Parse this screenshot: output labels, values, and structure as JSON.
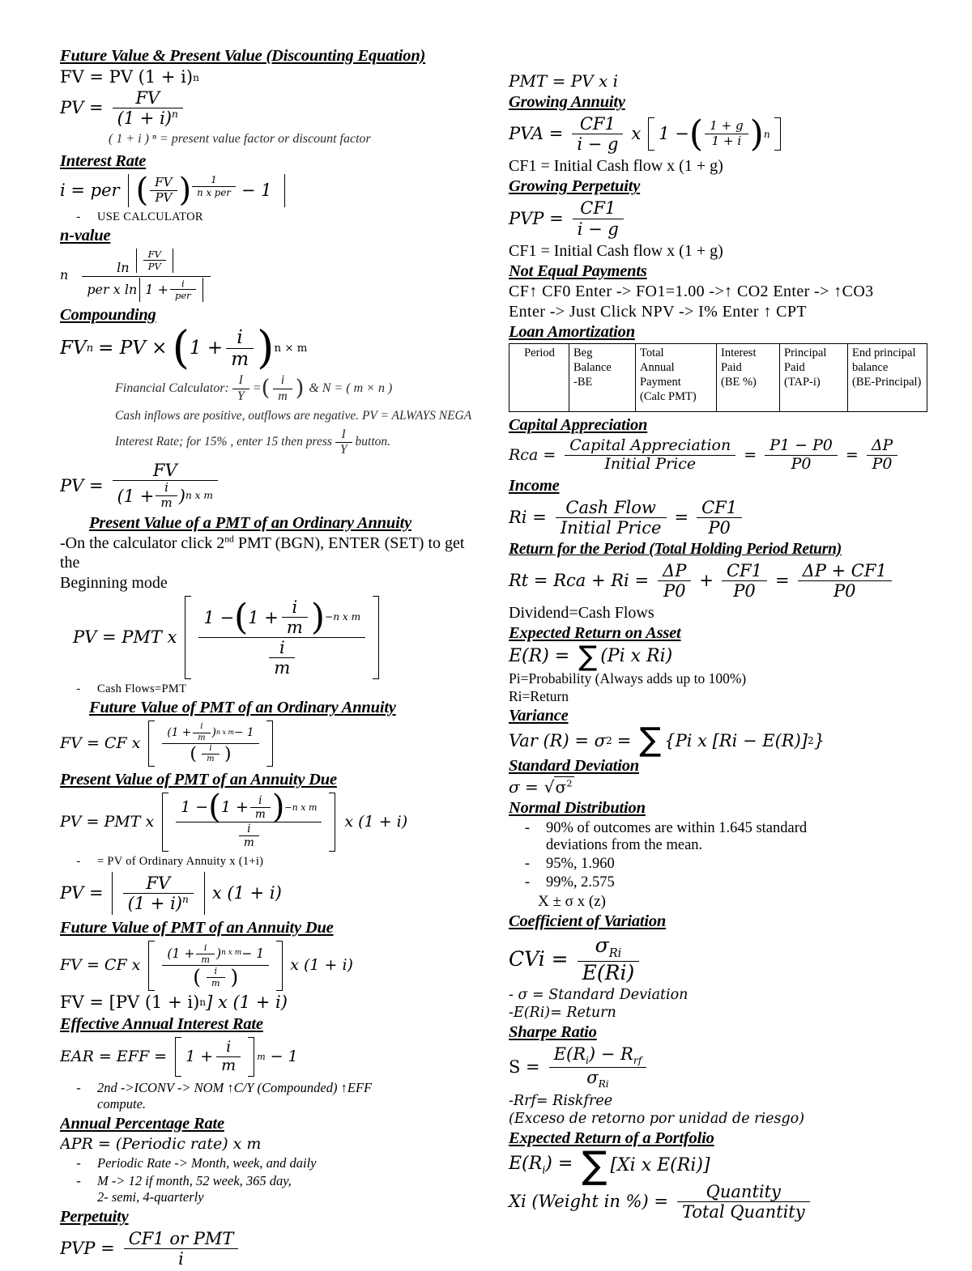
{
  "document": {
    "type": "finance-formula-cheat-sheet",
    "title": "Finance Formula Sheet"
  },
  "left_column": {
    "s1": {
      "heading": "Future Value & Present Value (Discounting Equation)",
      "fv_line": "FV = PV (1 + i)",
      "fv_exp": "n",
      "pv_lhs": "PV =",
      "pv_num": "FV",
      "pv_den_base": "(1 + i)",
      "pv_den_exp": "n",
      "factor_note": "( 1 + i ) ⁿ = present value factor or discount factor"
    },
    "s2": {
      "heading": "Interest Rate",
      "lhs": "i  =  per",
      "frac_num": "FV",
      "frac_den": "PV",
      "exp_num": "1",
      "exp_den": "n x per",
      "minus_one": "− 1",
      "bullet": "USE CALCULATOR"
    },
    "s3": {
      "heading": "n-value",
      "lhs": "n",
      "num_ln": "ln",
      "num_frac_num": "FV",
      "num_frac_den": "PV",
      "den_pre": "per x ln",
      "den_one": "1 +",
      "den_frac_num": "i",
      "den_frac_den": "per"
    },
    "s4": {
      "heading": "Compounding",
      "lhs": "FV",
      "lhs_sub": "n",
      "eq_mid": "= PV ×",
      "one_plus": "1 +",
      "frac_num": "i",
      "frac_den": "m",
      "exp": "n × m",
      "calc_note_pre": "Financial Calculator:",
      "calc_i": "I",
      "calc_y": "Y",
      "calc_eq": "=",
      "calc_fi": "i",
      "calc_fm": "m",
      "calc_tail": "&  N = ( m × n )",
      "note_cash": "Cash inflows are positive, outflows are negative. PV = ALWAYS NEGA",
      "note_rate_pre": "Interest Rate; for 15% , enter 15 then press",
      "note_rate_i": "I",
      "note_rate_y": "Y",
      "note_rate_post": "button."
    },
    "s5": {
      "lhs": "PV =",
      "num": "FV",
      "den_open": "(1 +",
      "den_fi": "i",
      "den_fm": "m",
      "den_close": ")",
      "den_exp": "n x m"
    },
    "s6": {
      "heading": "Present Value of a PMT of an Ordinary Annuity",
      "line1": "-On the calculator click 2",
      "line1_sup": "nd",
      "line1_rest": " PMT (BGN), ENTER (SET) to get the",
      "line2": "Beginning mode",
      "lhs": "PV = PMT x",
      "num_one_minus": "1 −",
      "num_one_plus": "1 +",
      "num_fi": "i",
      "num_fm": "m",
      "num_exp": "−n x m",
      "den_fi": "i",
      "den_fm": "m",
      "bullet": "Cash Flows=PMT"
    },
    "s7": {
      "heading": "Future Value of PMT of an Ordinary Annuity",
      "lhs": "FV = CF x",
      "num_open": "(1 +",
      "num_fi": "i",
      "num_fm": "m",
      "num_close": ")",
      "num_exp": "n x m",
      "num_minus": "− 1",
      "den_fi": "i",
      "den_fm": "m"
    },
    "s8": {
      "heading": "Present Value of PMT of an Annuity Due",
      "lhs": "PV = PMT x",
      "num_one_minus": "1 −",
      "num_one_plus": "1 +",
      "num_fi": "i",
      "num_fm": "m",
      "num_exp": "−n x m",
      "den_fi": "i",
      "den_fm": "m",
      "tail": "x (1 + i)",
      "bullet": "= PV of Ordinary Annuity x (1+i)",
      "pv2_lhs": "PV =",
      "pv2_num": "FV",
      "pv2_den": "(1 + i)",
      "pv2_den_exp": "n",
      "pv2_tail": "x (1 + i)"
    },
    "s9": {
      "heading": "Future Value of PMT of an Annuity Due",
      "lhs": "FV = CF x",
      "num_open": "(1 +",
      "num_fi": "i",
      "num_fm": "m",
      "num_close": ")",
      "num_exp": "n x m",
      "num_minus": "− 1",
      "den_fi": "i",
      "den_fm": "m",
      "tail": "x (1 + i)",
      "fv_line_pre": "FV = [PV (1 + i)",
      "fv_line_exp": "n",
      "fv_line_post": "] x (1 + i)"
    },
    "s10": {
      "heading": "Effective Annual Interest Rate",
      "lhs": "EAR = EFF =",
      "one_plus": "1 +",
      "fi": "i",
      "fm": "m",
      "exp": "m",
      "minus_one": "− 1",
      "bullet1": "2nd ->ICONV -> NOM ↑C/Y (Compounded) ↑EFF",
      "bullet1b": "compute."
    },
    "s11": {
      "heading": "Annual Percentage Rate",
      "formula": "APR = (Periodic rate) x m",
      "bullet1": "Periodic Rate -> Month, week, and daily",
      "bullet2": "M -> 12 if month, 52 week, 365 day,",
      "bullet2b": "2- semi, 4-quarterly"
    },
    "s12": {
      "heading": "Perpetuity",
      "lhs": "PVP =",
      "num": "CF1 or PMT",
      "den": "i"
    }
  },
  "right_column": {
    "r1": {
      "pmt_line": "PMT = PV x i"
    },
    "r2": {
      "heading": "Growing Annuity",
      "lhs": "PVA =",
      "f1_num": "CF1",
      "f1_den": "i − g",
      "x": "x",
      "one_minus": "1 −",
      "f2_num": "1 + g",
      "f2_den": "1 + i",
      "exp": "n",
      "cf_note": "CF1 = Initial Cash flow x (1 + g)"
    },
    "r3": {
      "heading": "Growing Perpetuity",
      "lhs": "PVP =",
      "num": "CF1",
      "den": "i − g",
      "cf_note": "CF1 = Initial Cash flow x (1 + g)"
    },
    "r4": {
      "heading": "Not Equal Payments",
      "line1": "CF↑ CF0 Enter -> FO1=1.00 ->↑ CO2 Enter -> ↑CO3",
      "line2": "Enter -> Just Click NPV -> I% Enter ↑ CPT"
    },
    "r5": {
      "heading": "Loan Amortization",
      "table": {
        "columns": [
          "Period",
          "Beg\nBalance\n-BE",
          "Total\nAnnual\nPayment\n(Calc PMT)",
          "Interest\nPaid\n(BE %)",
          "Principal\nPaid\n(TAP-i)",
          "End principal\nbalance\n(BE-Principal)"
        ],
        "rows": []
      }
    },
    "r6": {
      "heading": "Capital Appreciation",
      "lhs": "Rca =",
      "f1_num": "Capital Appreciation",
      "f1_den": "Initial Price",
      "eq1": "=",
      "f2_num": "P1 − P0",
      "f2_den": "P0",
      "eq2": "=",
      "f3_num": "ΔP",
      "f3_den": "P0"
    },
    "r7": {
      "heading": "Income",
      "lhs": "Ri =",
      "f1_num": "Cash Flow",
      "f1_den": "Initial Price",
      "eq1": "=",
      "f2_num": "CF1",
      "f2_den": "P0"
    },
    "r8": {
      "heading": "Return for the Period (Total Holding Period Return)",
      "lhs": "Rt = Rca + Ri =",
      "f1_num": "ΔP",
      "f1_den": "P0",
      "plus": "+",
      "f2_num": "CF1",
      "f2_den": "P0",
      "eq": "=",
      "f3_num": "ΔP + CF1",
      "f3_den": "P0",
      "dividend_note": "Dividend=Cash Flows"
    },
    "r9": {
      "heading": "Expected Return on Asset",
      "formula_lhs": "E(R) =",
      "formula_rhs": "(Pi x Ri)",
      "note1": "Pi=Probability (Always adds up to 100%)",
      "note2": "Ri=Return"
    },
    "r10": {
      "heading": "Variance",
      "lhs": "Var (R) =  σ",
      "lhs_exp": "2",
      "eq": "=",
      "rhs": "{Pi x [Ri − E(R)]",
      "rhs_exp": "2",
      "rhs_close": "}"
    },
    "r11": {
      "heading": "Standard Deviation",
      "lhs": "σ =",
      "radical": "√",
      "body": "σ",
      "body_exp": "2"
    },
    "r12": {
      "heading": "Normal Distribution",
      "bullets": [
        "90% of outcomes are within 1.645 standard",
        "deviations from the mean.",
        "95%, 1.960",
        "99%, 2.575"
      ],
      "x_line": "X ±  σ x (z)"
    },
    "r13": {
      "heading": "Coefficient of Variation",
      "lhs": "CVi =",
      "num": "σ",
      "num_sub": "Ri",
      "den": "E(Ri)",
      "note1": "- σ = Standard Deviation",
      "note2": "-E(Ri)= Return"
    },
    "r14": {
      "heading": "Sharpe Ratio",
      "lhs": "S =",
      "num_pre": "E(R",
      "num_sub": "i",
      "num_mid": ") − R",
      "num_sub2": "rf",
      "den": "σ",
      "den_sub": "Ri",
      "note1": "-Rrf= Riskfree",
      "note2": "(Exceso de retorno por unidad de riesgo)"
    },
    "r15": {
      "heading": "Expected Return of a Portfolio",
      "lhs_pre": "E(R",
      "lhs_sub": "i",
      "lhs_post": ") =",
      "rhs": "[Xi x E(Ri)]",
      "w_lhs": "Xi (Weight in %) =",
      "w_num": "Quantity",
      "w_den": "Total Quantity"
    }
  }
}
